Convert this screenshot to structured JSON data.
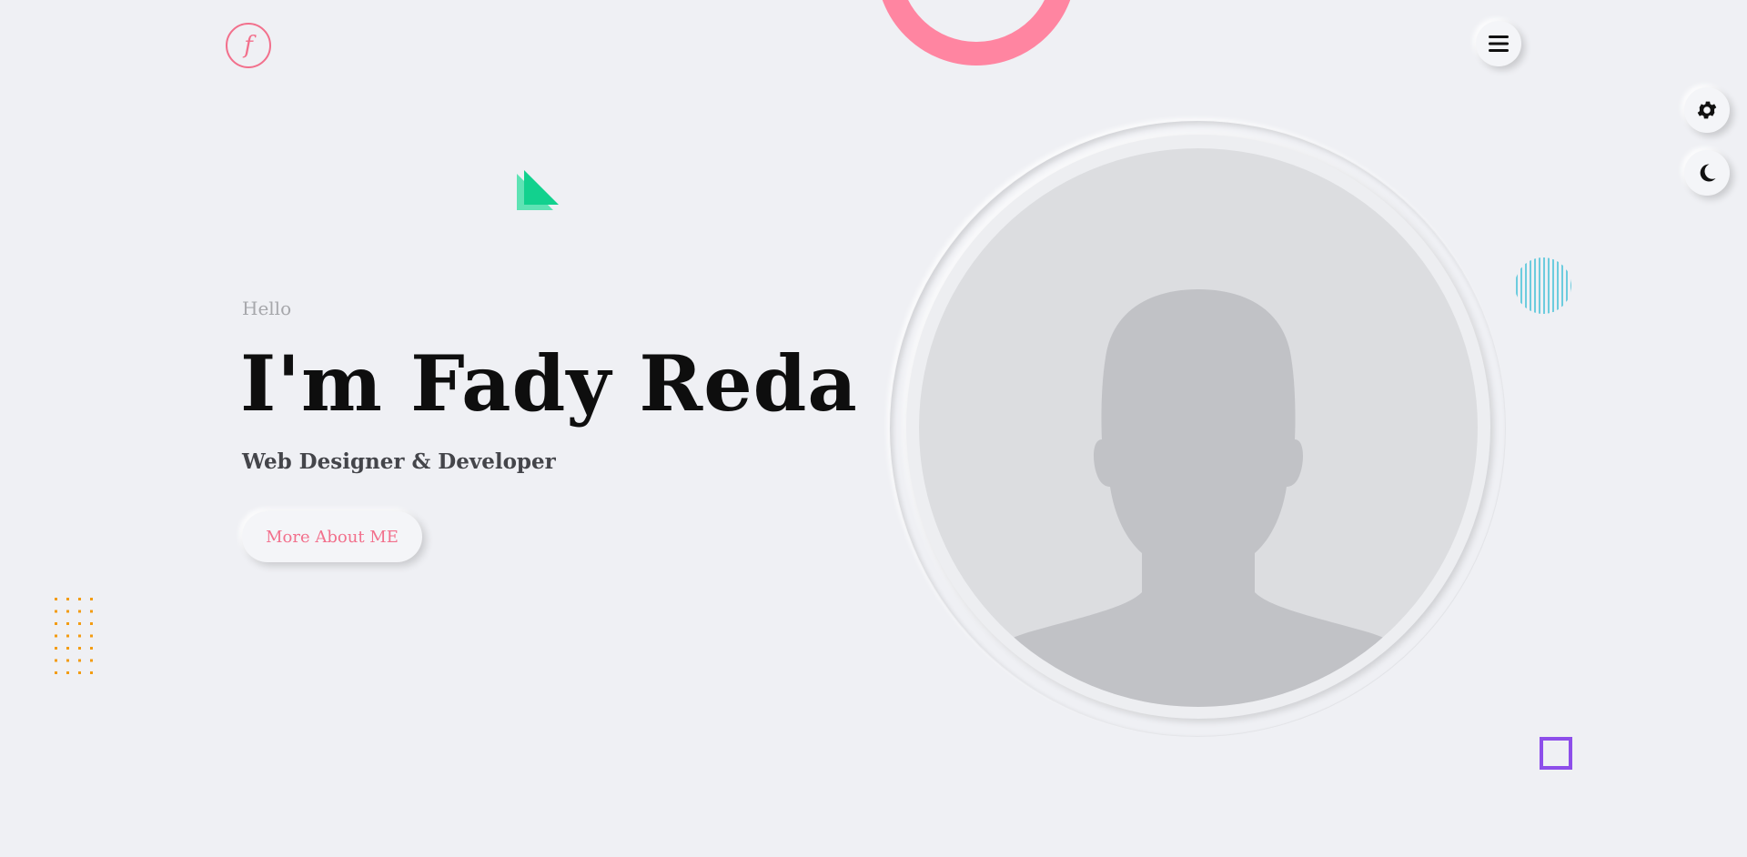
{
  "brand": {
    "logo_letter": "f"
  },
  "hero": {
    "greeting": "Hello",
    "name": "I'm Fady Reda",
    "role": "Web Designer & Developer",
    "cta_label": "More About ME"
  },
  "icons": {
    "menu": "hamburger-icon",
    "settings": "gear-icon",
    "theme": "moon-icon"
  },
  "colors": {
    "background": "#eff0f4",
    "accent_pink": "#f2708c",
    "pink_ring": "#ff85a1",
    "green": "#12d18e",
    "cyan": "#25b8d2",
    "orange": "#f39c12",
    "purple": "#8d4eea",
    "text_dark": "#0e0e0e"
  }
}
